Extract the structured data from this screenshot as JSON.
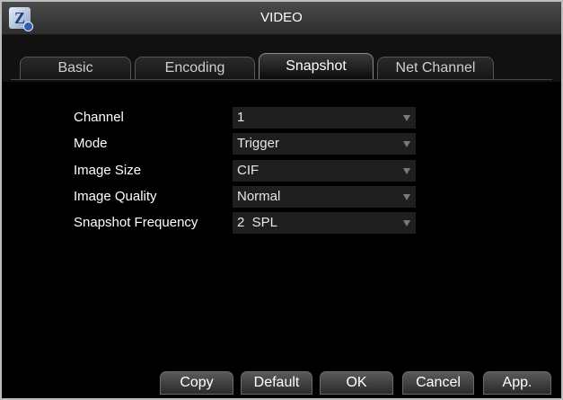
{
  "window": {
    "title": "VIDEO",
    "logo_icon": "app-logo-icon"
  },
  "tabs": [
    {
      "label": "Basic",
      "active": false
    },
    {
      "label": "Encoding",
      "active": false
    },
    {
      "label": "Snapshot",
      "active": true
    },
    {
      "label": "Net Channel",
      "active": false
    }
  ],
  "form": {
    "channel": {
      "label": "Channel",
      "value": "1"
    },
    "mode": {
      "label": "Mode",
      "value": "Trigger"
    },
    "image_size": {
      "label": "Image Size",
      "value": "CIF"
    },
    "image_quality": {
      "label": "Image Quality",
      "value": "Normal"
    },
    "snapshot_frequency": {
      "label": "Snapshot Frequency",
      "value": "2  SPL"
    }
  },
  "buttons": {
    "copy": "Copy",
    "default": "Default",
    "ok": "OK",
    "cancel": "Cancel",
    "apply": "App."
  }
}
